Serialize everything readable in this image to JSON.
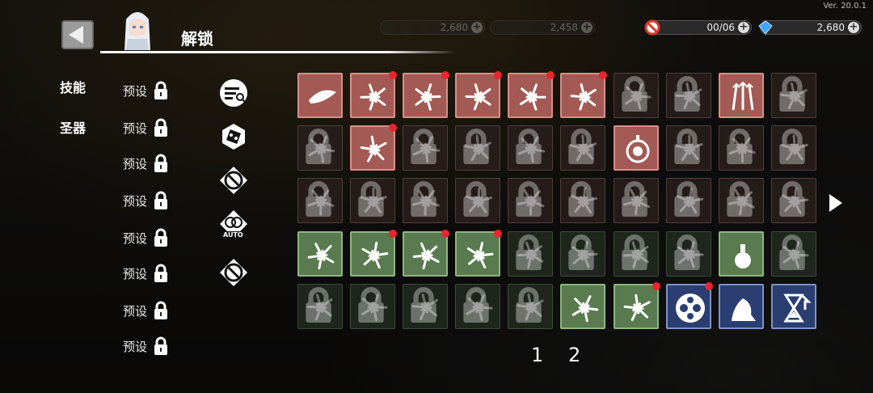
{
  "version": "Ver. 20.0.1",
  "header": {
    "title": "解锁",
    "currency": [
      {
        "value": "2,680",
        "icon": "diamond-icon"
      },
      {
        "value": "2,458",
        "icon": "gear-coin-icon"
      },
      {
        "value": "00/06",
        "icon": "no-entry-icon"
      },
      {
        "value": "2,680",
        "icon": "diamond-icon"
      }
    ]
  },
  "tabs": [
    "技能",
    "圣器"
  ],
  "presets": [
    "预设",
    "预设",
    "预设",
    "预设",
    "预设",
    "预设",
    "预设",
    "预设"
  ],
  "tools": [
    "filter-icon",
    "dice-icon",
    "prohibit-icon",
    "auto-icon",
    "prohibit-icon"
  ],
  "tool_auto_label": "AUTO",
  "pages": [
    "1",
    "2"
  ],
  "colors": {
    "red_cell": "#a35a55",
    "green_cell": "#597b4f",
    "blue_cell": "#2a3e71",
    "notify_dot": "#e7262f"
  },
  "grid": [
    [
      {
        "theme": "red",
        "unlocked": true,
        "dot": false,
        "icon": "slash-arc-icon"
      },
      {
        "theme": "red",
        "unlocked": true,
        "dot": true,
        "icon": "blade-swirl-icon"
      },
      {
        "theme": "red",
        "unlocked": true,
        "dot": true,
        "icon": "burst-flower-icon"
      },
      {
        "theme": "red",
        "unlocked": true,
        "dot": true,
        "icon": "explosion-icon"
      },
      {
        "theme": "red",
        "unlocked": true,
        "dot": true,
        "icon": "arrow-jump-icon"
      },
      {
        "theme": "red",
        "unlocked": true,
        "dot": true,
        "icon": "lantern-icon"
      },
      {
        "theme": "red",
        "unlocked": false,
        "dot": false,
        "icon": "lantern-icon"
      },
      {
        "theme": "red",
        "unlocked": false,
        "dot": false,
        "icon": "ring-spikes-icon"
      },
      {
        "theme": "red",
        "unlocked": true,
        "dot": false,
        "icon": "triple-arrow-icon"
      },
      {
        "theme": "red",
        "unlocked": false,
        "dot": false,
        "icon": "toxic-icon"
      }
    ],
    [
      {
        "theme": "red",
        "unlocked": false,
        "dot": false,
        "icon": "claw-icon"
      },
      {
        "theme": "red",
        "unlocked": true,
        "dot": true,
        "icon": "wind-slash-icon"
      },
      {
        "theme": "red",
        "unlocked": false,
        "dot": false,
        "icon": "feather-icon"
      },
      {
        "theme": "red",
        "unlocked": false,
        "dot": false,
        "icon": "spark-icon"
      },
      {
        "theme": "red",
        "unlocked": false,
        "dot": false,
        "icon": "shatter-icon"
      },
      {
        "theme": "red",
        "unlocked": false,
        "dot": false,
        "icon": "vortex-icon"
      },
      {
        "theme": "red",
        "unlocked": true,
        "dot": false,
        "icon": "target-icon"
      },
      {
        "theme": "red",
        "unlocked": false,
        "dot": false,
        "icon": "chain-icon"
      },
      {
        "theme": "red",
        "unlocked": false,
        "dot": false,
        "icon": "beast-icon"
      },
      {
        "theme": "red",
        "unlocked": false,
        "dot": false,
        "icon": "fist-icon"
      }
    ],
    [
      {
        "theme": "red",
        "unlocked": false,
        "dot": false,
        "icon": "orbit-icon"
      },
      {
        "theme": "red",
        "unlocked": false,
        "dot": false,
        "icon": "leaf-slash-icon"
      },
      {
        "theme": "red",
        "unlocked": false,
        "dot": false,
        "icon": "lightning-orb-icon"
      },
      {
        "theme": "red",
        "unlocked": false,
        "dot": false,
        "icon": "comet-icon"
      },
      {
        "theme": "red",
        "unlocked": false,
        "dot": false,
        "icon": "spear-icon"
      },
      {
        "theme": "red",
        "unlocked": false,
        "dot": false,
        "icon": "slash-cross-icon"
      },
      {
        "theme": "red",
        "unlocked": false,
        "dot": false,
        "icon": "pulse-icon"
      },
      {
        "theme": "red",
        "unlocked": false,
        "dot": false,
        "icon": "fire-orb-icon"
      },
      {
        "theme": "red",
        "unlocked": false,
        "dot": false,
        "icon": "grass-icon"
      },
      {
        "theme": "red",
        "unlocked": false,
        "dot": false,
        "icon": "flame-burst-icon"
      }
    ],
    [
      {
        "theme": "green",
        "unlocked": true,
        "dot": false,
        "icon": "ground-slam-icon"
      },
      {
        "theme": "green",
        "unlocked": true,
        "dot": true,
        "icon": "thorn-chain-icon"
      },
      {
        "theme": "green",
        "unlocked": true,
        "dot": true,
        "icon": "sword-dash-icon"
      },
      {
        "theme": "green",
        "unlocked": true,
        "dot": true,
        "icon": "runner-icon"
      },
      {
        "theme": "green",
        "unlocked": false,
        "dot": false,
        "icon": "flower-icon"
      },
      {
        "theme": "green",
        "unlocked": false,
        "dot": false,
        "icon": "skull-icon"
      },
      {
        "theme": "green",
        "unlocked": false,
        "dot": false,
        "icon": "biohazard-icon"
      },
      {
        "theme": "green",
        "unlocked": false,
        "dot": false,
        "icon": "sword-icon"
      },
      {
        "theme": "green",
        "unlocked": true,
        "dot": false,
        "icon": "potion-icon"
      },
      {
        "theme": "green",
        "unlocked": false,
        "dot": false,
        "icon": "bow-icon"
      }
    ],
    [
      {
        "theme": "green",
        "unlocked": false,
        "dot": false,
        "icon": "graves-icon"
      },
      {
        "theme": "green",
        "unlocked": false,
        "dot": false,
        "icon": "web-icon"
      },
      {
        "theme": "green",
        "unlocked": false,
        "dot": false,
        "icon": "dust-icon"
      },
      {
        "theme": "green",
        "unlocked": false,
        "dot": false,
        "icon": "crystal-icon"
      },
      {
        "theme": "green",
        "unlocked": false,
        "dot": false,
        "icon": "whirl-icon"
      },
      {
        "theme": "green",
        "unlocked": true,
        "dot": false,
        "icon": "streak-icon"
      },
      {
        "theme": "green",
        "unlocked": true,
        "dot": true,
        "icon": "splash-icon"
      },
      {
        "theme": "blue",
        "unlocked": true,
        "dot": true,
        "icon": "soccer-icon"
      },
      {
        "theme": "blue",
        "unlocked": true,
        "dot": false,
        "icon": "ghost-icon"
      },
      {
        "theme": "blue",
        "unlocked": true,
        "dot": false,
        "icon": "hourglass-icon"
      }
    ]
  ]
}
